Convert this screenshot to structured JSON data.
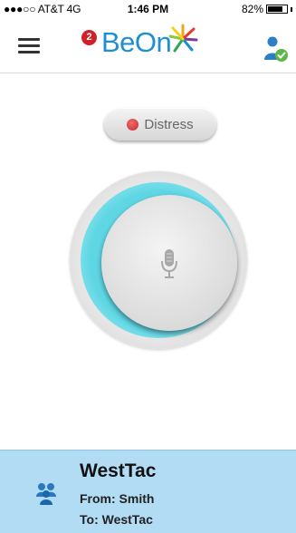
{
  "status_bar": {
    "carrier": "●●●○○ AT&T  4G",
    "time": "1:46 PM",
    "battery_text": "82%",
    "battery_level": 0.82
  },
  "header": {
    "badge_count": "2",
    "logo_text": "BeOn",
    "menu_icon": "hamburger-menu-icon",
    "user_icon": "user-verified-icon"
  },
  "distress": {
    "label": "Distress",
    "dot_color": "#d9393a"
  },
  "ptt": {
    "icon": "microphone-icon",
    "glow_color": "#5fd6e4"
  },
  "talkgroup": {
    "name": "WestTac",
    "from": "From: Smith",
    "to": "To: WestTac",
    "icon": "group-users-icon",
    "background": "#b2dcf4"
  }
}
